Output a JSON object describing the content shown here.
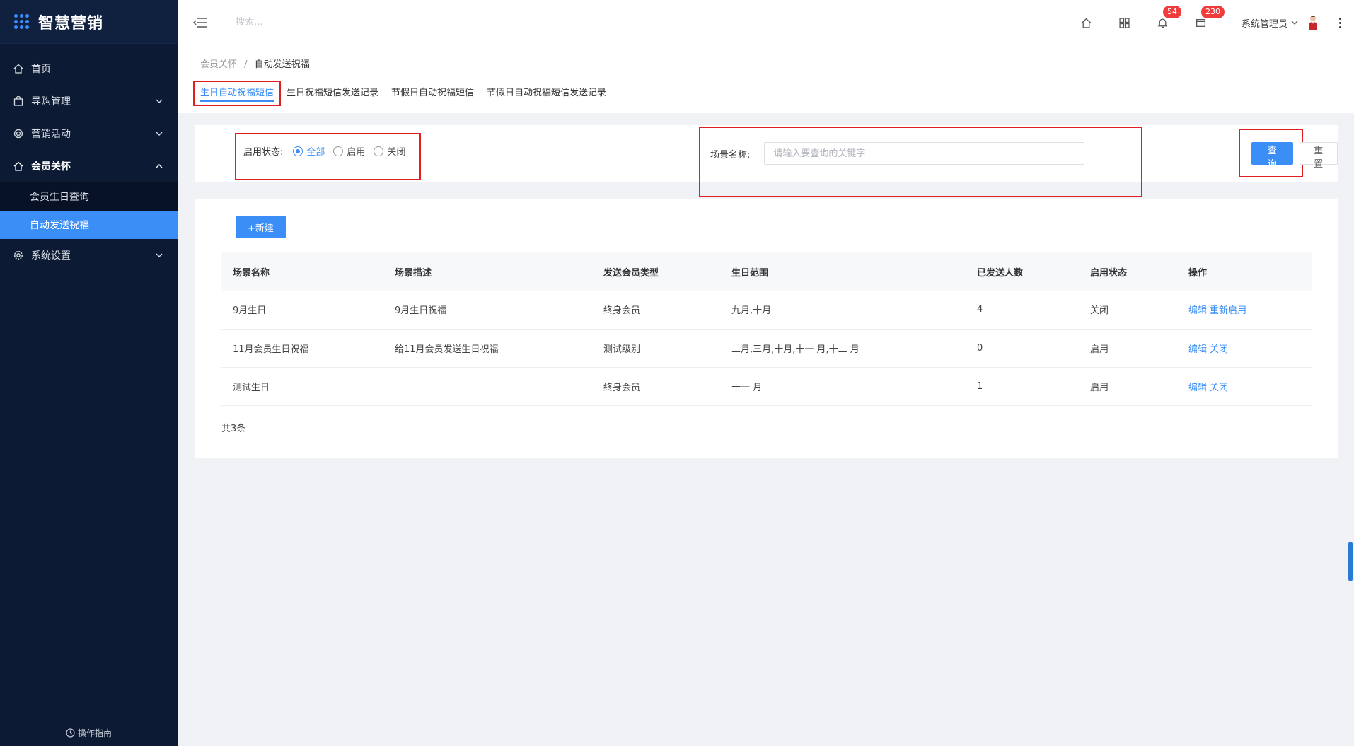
{
  "app": {
    "name": "智慧营销"
  },
  "sidebar": {
    "items": [
      {
        "label": "首页",
        "icon": "home-icon",
        "expandable": false
      },
      {
        "label": "导购管理",
        "icon": "bag-icon",
        "expandable": true
      },
      {
        "label": "营销活动",
        "icon": "target-icon",
        "expandable": true
      },
      {
        "label": "会员关怀",
        "icon": "home-icon",
        "expandable": true,
        "open": true,
        "children": [
          {
            "label": "会员生日查询"
          },
          {
            "label": "自动发送祝福",
            "active": true
          }
        ]
      },
      {
        "label": "系统设置",
        "icon": "gear-icon",
        "expandable": true
      }
    ],
    "guide_label": "操作指南"
  },
  "header": {
    "search_placeholder": "搜索...",
    "notify_badge": "54",
    "message_badge": "230",
    "user_name": "系统管理员"
  },
  "breadcrumb": {
    "parent": "会员关怀",
    "separator": "/",
    "current": "自动发送祝福"
  },
  "tabs": [
    {
      "label": "生日自动祝福短信",
      "active": true
    },
    {
      "label": "生日祝福短信发送记录"
    },
    {
      "label": "节假日自动祝福短信"
    },
    {
      "label": "节假日自动祝福短信发送记录"
    }
  ],
  "filter": {
    "status_label": "启用状态:",
    "status_options": [
      {
        "label": "全部",
        "checked": true
      },
      {
        "label": "启用",
        "checked": false
      },
      {
        "label": "关闭",
        "checked": false
      }
    ],
    "scene_label": "场景名称:",
    "scene_placeholder": "请输入要查询的关键字",
    "query_label": "查询",
    "reset_label": "重置"
  },
  "table": {
    "new_label": "+新建",
    "columns": [
      "场景名称",
      "场景描述",
      "发送会员类型",
      "生日范围",
      "已发送人数",
      "启用状态",
      "操作"
    ],
    "rows": [
      {
        "name": "9月生日",
        "desc": "9月生日祝福",
        "member_type": "终身会员",
        "range": "九月,十月",
        "sent": "4",
        "status": "关闭",
        "ops": [
          "编辑",
          "重新启用"
        ]
      },
      {
        "name": "11月会员生日祝福",
        "desc": "给11月会员发送生日祝福",
        "member_type": "测试级别",
        "range": "二月,三月,十月,十一 月,十二 月",
        "sent": "0",
        "status": "启用",
        "ops": [
          "编辑",
          "关闭"
        ]
      },
      {
        "name": "测试生日",
        "desc": "",
        "member_type": "终身会员",
        "range": "十一 月",
        "sent": "1",
        "status": "启用",
        "ops": [
          "编辑",
          "关闭"
        ]
      }
    ],
    "total_text": "共3条"
  },
  "colors": {
    "accent": "#3a8ef6",
    "sidebar_bg": "#0c1b33",
    "highlight_box": "#e02020",
    "badge": "#f03c3c"
  }
}
